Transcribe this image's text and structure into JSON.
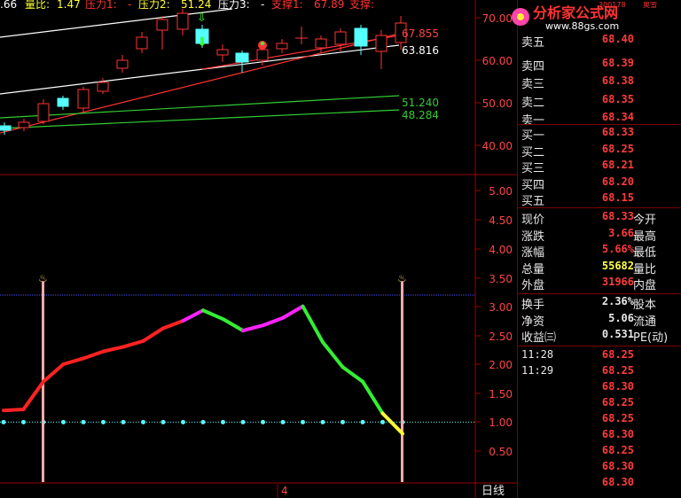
{
  "indicator_bar": {
    "prefix": ".66",
    "items": [
      {
        "label": "量比:",
        "value": "1.47",
        "color": "#ffff33"
      },
      {
        "label": "压力1:",
        "value": "-",
        "color": "#ff3333"
      },
      {
        "label": "压力2:",
        "value": "51.24",
        "color": "#ffff33"
      },
      {
        "label": "压力3:",
        "value": "-",
        "color": "#ffffff"
      },
      {
        "label": "支撑1:",
        "value": "67.89",
        "color": "#ff3333"
      },
      {
        "label": "支撑:",
        "value": "",
        "color": "#ff3333"
      }
    ]
  },
  "logo": {
    "text": "分析家公式网",
    "url": "www.88gs.com",
    "code": "300178",
    "name": "奥雪"
  },
  "main_chart": {
    "right_axis": [
      "70.00",
      "60.00",
      "50.00",
      "40.00"
    ],
    "line_labels": [
      {
        "text": "67.855",
        "color": "#ff4444"
      },
      {
        "text": "63.816",
        "color": "#ffffff"
      },
      {
        "text": "51.240",
        "color": "#33cc33"
      },
      {
        "text": "48.284",
        "color": "#33cc33"
      }
    ]
  },
  "sub_chart": {
    "right_axis": [
      "5.00",
      "4.50",
      "4.00",
      "3.50",
      "3.00",
      "2.50",
      "2.00",
      "1.50",
      "1.00",
      "0.50"
    ],
    "date_label": "4",
    "period_label": "日线"
  },
  "chart_data": {
    "type": "line",
    "title": "",
    "ylim": [
      0,
      5.3
    ],
    "reference_lines": [
      3.2,
      1.0
    ],
    "series": [
      {
        "values": [
          1.2,
          1.22,
          1.7,
          2.0,
          2.1,
          2.22,
          2.3,
          2.4,
          2.62,
          2.75,
          2.93,
          2.78,
          2.58,
          2.67,
          2.8,
          3.0,
          2.38,
          1.95,
          1.7,
          1.15,
          0.8
        ]
      }
    ]
  },
  "quote_panel": {
    "sell": [
      {
        "label": "卖五",
        "value": "68.40"
      },
      {
        "label": "卖四",
        "value": "68.39"
      },
      {
        "label": "卖三",
        "value": "68.38"
      },
      {
        "label": "卖二",
        "value": "68.35"
      },
      {
        "label": "卖一",
        "value": "68.34"
      }
    ],
    "buy": [
      {
        "label": "买一",
        "value": "68.33"
      },
      {
        "label": "买二",
        "value": "68.25"
      },
      {
        "label": "买三",
        "value": "68.21"
      },
      {
        "label": "买四",
        "value": "68.20"
      },
      {
        "label": "买五",
        "value": "68.15"
      }
    ],
    "stats": [
      {
        "label": "现价",
        "value": "68.33",
        "color": "#ff3b3b",
        "label2": "今开"
      },
      {
        "label": "涨跌",
        "value": "3.66",
        "color": "#ff3b3b",
        "label2": "最高"
      },
      {
        "label": "涨幅",
        "value": "5.66%",
        "color": "#ff3b3b",
        "label2": "最低"
      },
      {
        "label": "总量",
        "value": "55682",
        "color": "#ffff44",
        "label2": "量比"
      },
      {
        "label": "外盘",
        "value": "31966",
        "color": "#ff3b3b",
        "label2": "内盘"
      }
    ],
    "stats2": [
      {
        "label": "换手",
        "value": "2.36%",
        "label2": "股本"
      },
      {
        "label": "净资",
        "value": "5.06",
        "label2": "流通"
      },
      {
        "label": "收益㈢",
        "value": "0.531",
        "label2": "PE(动)"
      }
    ],
    "ticks": [
      {
        "time": "11:28",
        "price": "68.25"
      },
      {
        "time": "11:29",
        "price": "68.25"
      },
      {
        "time": "",
        "price": "68.30"
      },
      {
        "time": "",
        "price": "68.25"
      },
      {
        "time": "",
        "price": "68.25"
      },
      {
        "time": "",
        "price": "68.30"
      },
      {
        "time": "",
        "price": "68.25"
      },
      {
        "time": "",
        "price": "68.30"
      },
      {
        "time": "",
        "price": "68.30"
      }
    ]
  }
}
